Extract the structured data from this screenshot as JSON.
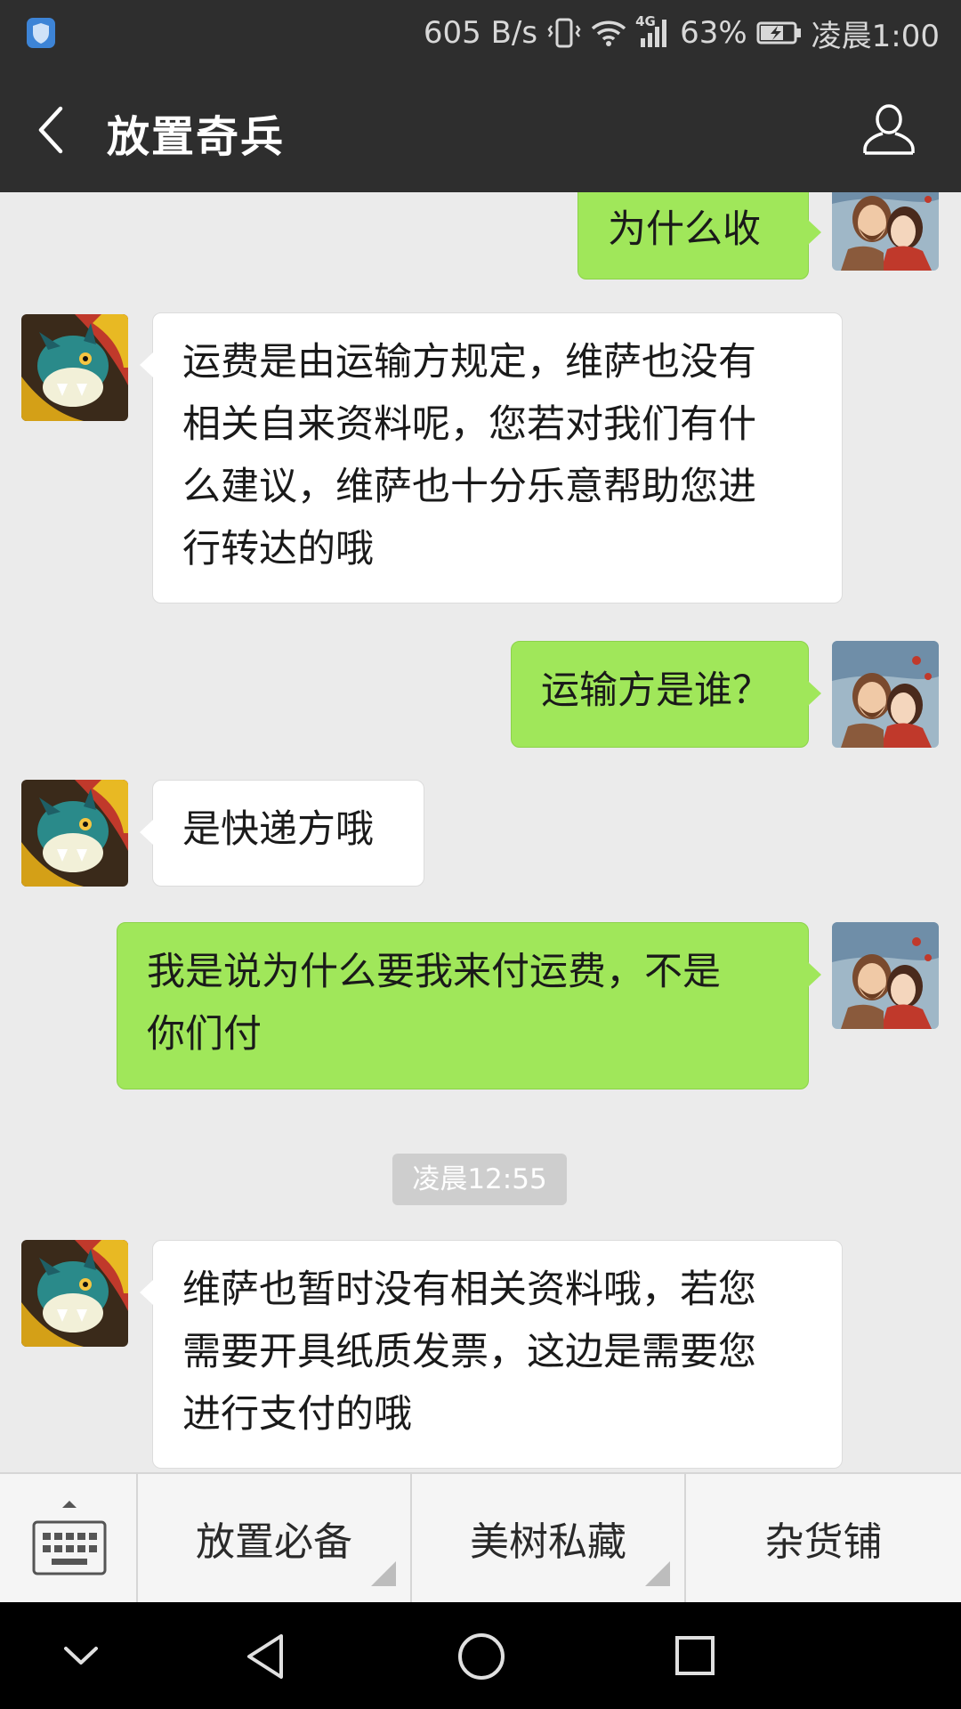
{
  "status_bar": {
    "net_speed": "605 B/s",
    "network": "4G",
    "battery": "63%",
    "time": "凌晨1:00",
    "icons": [
      "shield-icon",
      "vibrate-icon",
      "wifi-icon",
      "signal-icon",
      "battery-charging-icon"
    ]
  },
  "header": {
    "title": "放置奇兵",
    "back_icon": "chevron-left-icon",
    "profile_icon": "person-icon"
  },
  "messages": [
    {
      "sender": "me",
      "text": "为什么收"
    },
    {
      "sender": "them",
      "text": "运费是由运输方规定，维萨也没有\n相关自来资料呢，您若对我们有什\n么建议，维萨也十分乐意帮助您进\n行转达的哦"
    },
    {
      "sender": "me",
      "text": "运输方是谁？"
    },
    {
      "sender": "them",
      "text": "是快递方哦"
    },
    {
      "sender": "me",
      "text": "我是说为什么要我来付运费，不是\n你们付"
    },
    {
      "sender": "them",
      "text": "维萨也暂时没有相关资料哦，若您\n需要开具纸质发票，这边是需要您\n进行支付的哦"
    }
  ],
  "timestamp": "凌晨12:55",
  "menu": {
    "keyboard_icon": "keyboard-icon",
    "items": [
      "放置必备",
      "美树私藏",
      "杂货铺"
    ]
  },
  "nav": {
    "icons": [
      "chevron-down-icon",
      "back-triangle-icon",
      "home-circle-icon",
      "recents-square-icon"
    ]
  },
  "colors": {
    "header_bg": "#2e2e2e",
    "chat_bg": "#ebebeb",
    "outgoing_bubble": "#a0e75a",
    "incoming_bubble": "#ffffff"
  }
}
